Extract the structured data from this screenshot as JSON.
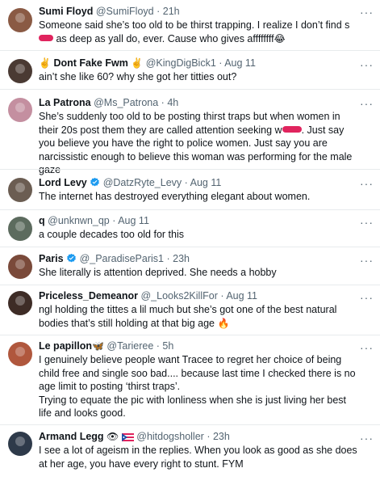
{
  "tweets": [
    {
      "name": "Sumi Floyd",
      "handle": "@SumiFloyd",
      "dot": "·",
      "time": "21h",
      "text_pre": "Someone said she’s too old to be thirst trapping. I realize I don’t find s",
      "text_post": " as deep as yall do, ever. Cause who gives affffffff",
      "emoji": "😂",
      "more": "···",
      "avatar_color": "#8a5a44"
    },
    {
      "name": "Dont Fake Fwm",
      "name_prefix": "✌️",
      "name_suffix": "✌️",
      "handle": "@KingDigBick1",
      "dot": "·",
      "time": "Aug 11",
      "text": "ain’t she like 60? why she got her titties out?",
      "more": "···",
      "avatar_color": "#4a3a33"
    },
    {
      "name": "La Patrona",
      "handle": "@Ms_Patrona",
      "dot": "·",
      "time": "4h",
      "text_pre": "She’s suddenly too old to be posting thirst traps but when women in their 20s post them they are called attention seeking w",
      "text_post": ". Just say you believe you have the right to police women. Just say you are narcissistic enough to believe this woman was performing for the male gaze",
      "more": "···",
      "avatar_color": "#c48fa0"
    },
    {
      "name": "Lord Levy",
      "handle": "@DatzRyte_Levy",
      "dot": "·",
      "time": "Aug 11",
      "text": "The internet has destroyed everything elegant about women.",
      "more": "···",
      "avatar_color": "#6b5d52",
      "verified_color": "#1d9bf0"
    },
    {
      "name": "q",
      "handle": "@unknwn_qp",
      "dot": "·",
      "time": "Aug 11",
      "text": "a couple decades too old for this",
      "more": "···",
      "avatar_color": "#5c6b5e"
    },
    {
      "name": "Paris",
      "handle": "@_ParadiseParis1",
      "dot": "·",
      "time": "23h",
      "text": "She literally is attention deprived. She needs a hobby",
      "more": "···",
      "avatar_color": "#7a4a3a",
      "verified_color": "#1d9bf0"
    },
    {
      "name": "Priceless_Demeanor",
      "handle": "@_Looks2KillFor",
      "dot": "·",
      "time": "Aug 11",
      "text": "ngl holding the tittes a lil much but she’s got one of the best natural bodies that’s still holding at that big age",
      "emoji": "🔥",
      "more": "···",
      "avatar_color": "#3e2c26"
    },
    {
      "name": "Le papillon",
      "name_suffix": "🦋",
      "handle": "@Tarieree",
      "dot": "·",
      "time": "5h",
      "text": "I genuinely believe people want Tracee to regret her choice of being child free and single soo bad.... because last time I checked there is no age limit to posting ‘thirst traps’.",
      "text2": "Trying to equate the pic with lonliness when she is just living her best life and looks good.",
      "more": "···",
      "avatar_color": "#b0573d"
    },
    {
      "name": "Armand Legg",
      "name_suffix": "👁",
      "handle": "@hitdogsholler",
      "dot": "·",
      "time": "23h",
      "text": "I see a lot of ageism in the replies. When you look as good as she does at her age, you have every right to stunt. FYM",
      "more": "···",
      "avatar_color": "#2e3a4a"
    }
  ],
  "colors": {
    "text": "#0f1419",
    "secondary": "#536471",
    "verified": "#1d9bf0",
    "redaction": "#e0245e"
  }
}
